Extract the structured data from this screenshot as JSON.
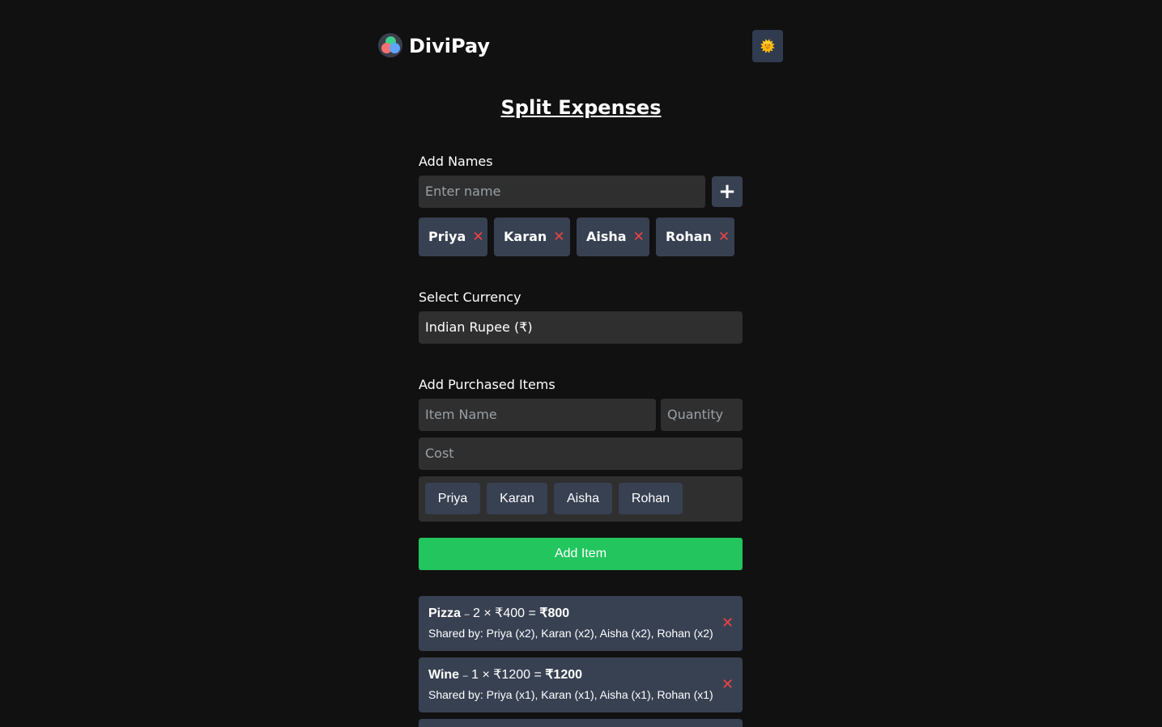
{
  "app": {
    "brand": "DiviPay",
    "theme_toggle_icon": "sun-icon",
    "theme_toggle_glyph": "🌞"
  },
  "page_title": "Split Expenses",
  "names_section": {
    "label": "Add Names",
    "input_placeholder": "Enter name",
    "add_glyph": "+",
    "names": [
      "Priya",
      "Karan",
      "Aisha",
      "Rohan"
    ],
    "remove_glyph": "✕"
  },
  "currency_section": {
    "label": "Select Currency",
    "selected": "Indian Rupee (₹)"
  },
  "items_section": {
    "label": "Add Purchased Items",
    "item_name_placeholder": "Item Name",
    "quantity_placeholder": "Quantity",
    "cost_placeholder": "Cost",
    "share_options": [
      "Priya",
      "Karan",
      "Aisha",
      "Rohan"
    ],
    "add_button": "Add Item"
  },
  "items": [
    {
      "name": "Pizza",
      "dash": "–",
      "calc": " 2 × ₹400 = ",
      "total": "₹800",
      "shared": "Shared by: Priya (x2), Karan (x2), Aisha (x2), Rohan (x2)",
      "remove_glyph": "✕"
    },
    {
      "name": "Wine",
      "dash": "–",
      "calc": " 1 × ₹1200 = ",
      "total": "₹1200",
      "shared": "Shared by: Priya (x1), Karan (x1), Aisha (x1), Rohan (x1)",
      "remove_glyph": "✕"
    }
  ]
}
